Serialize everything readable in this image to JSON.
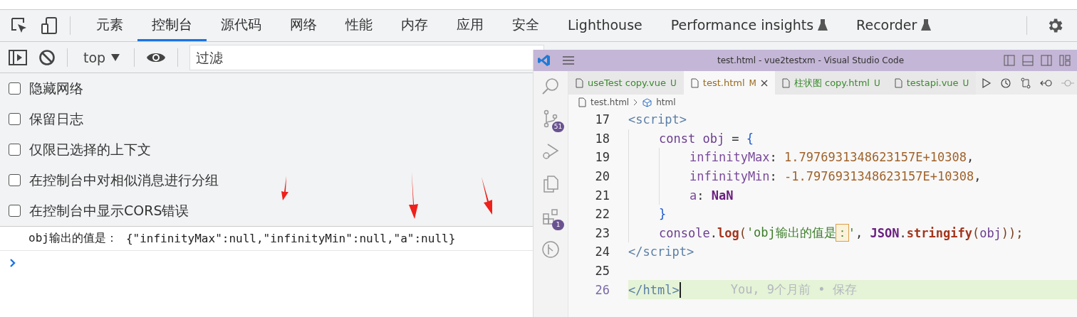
{
  "devtools": {
    "tabs": [
      {
        "label": "元素",
        "selected": false,
        "experimental": false
      },
      {
        "label": "控制台",
        "selected": true,
        "experimental": false
      },
      {
        "label": "源代码",
        "selected": false,
        "experimental": false
      },
      {
        "label": "网络",
        "selected": false,
        "experimental": false
      },
      {
        "label": "性能",
        "selected": false,
        "experimental": false
      },
      {
        "label": "内存",
        "selected": false,
        "experimental": false
      },
      {
        "label": "应用",
        "selected": false,
        "experimental": false
      },
      {
        "label": "安全",
        "selected": false,
        "experimental": false
      },
      {
        "label": "Lighthouse",
        "selected": false,
        "experimental": false
      },
      {
        "label": "Performance insights",
        "selected": false,
        "experimental": true
      },
      {
        "label": "Recorder",
        "selected": false,
        "experimental": true
      }
    ],
    "toolbar": {
      "context": "top",
      "filter": {
        "placeholder": "过滤"
      }
    },
    "settings": [
      {
        "label": "隐藏网络",
        "checked": false
      },
      {
        "label": "保留日志",
        "checked": false
      },
      {
        "label": "仅限已选择的上下文",
        "checked": false
      },
      {
        "label": "在控制台中对相似消息进行分组",
        "checked": false
      },
      {
        "label": "在控制台中显示CORS错误",
        "checked": false
      }
    ],
    "console": {
      "messages": [
        {
          "label": "obj输出的值是：",
          "value": "{\"infinityMax\":null,\"infinityMin\":null,\"a\":null}"
        }
      ]
    }
  },
  "vscode": {
    "window": {
      "title": "test.html - vue2testxm - Visual Studio Code"
    },
    "activity_bar": {
      "source_control_badge": "51",
      "extensions_badge": "1"
    },
    "tabs": [
      {
        "name": "useTest copy.vue",
        "status": "U",
        "color": "#3a8a2e",
        "selected": false
      },
      {
        "name": "test.html",
        "status": "M",
        "color": "#9a6a1c",
        "selected": true
      },
      {
        "name": "柱状图 copy.html",
        "status": "U",
        "color": "#3a8a2e",
        "selected": false
      },
      {
        "name": "testapi.vue",
        "status": "U",
        "color": "#3a8a2e",
        "selected": false
      }
    ],
    "breadcrumb": [
      "test.html",
      "html"
    ],
    "lines": [
      {
        "number": "17",
        "current": false,
        "kind": "top",
        "tokens": [
          {
            "kind": "tag",
            "text": "<script>"
          }
        ]
      },
      {
        "number": "18",
        "current": false,
        "kind": "body",
        "tokens": [
          {
            "kind": "keyword",
            "text": "const obj"
          },
          {
            "kind": "plain",
            "text": " = "
          },
          {
            "kind": "brace",
            "text": "{"
          }
        ]
      },
      {
        "number": "19",
        "current": false,
        "kind": "member",
        "tokens": [
          {
            "kind": "prop",
            "text": "infinityMax"
          },
          {
            "kind": "plain",
            "text": ": "
          },
          {
            "kind": "number",
            "text": "1.7976931348623157E+10308"
          },
          {
            "kind": "plain",
            "text": ","
          }
        ]
      },
      {
        "number": "20",
        "current": false,
        "kind": "member",
        "tokens": [
          {
            "kind": "prop",
            "text": "infinityMin"
          },
          {
            "kind": "plain",
            "text": ": "
          },
          {
            "kind": "number",
            "text": "-1.7976931348623157E+10308"
          },
          {
            "kind": "plain",
            "text": ","
          }
        ]
      },
      {
        "number": "21",
        "current": false,
        "kind": "member",
        "tokens": [
          {
            "kind": "prop",
            "text": "a"
          },
          {
            "kind": "plain",
            "text": ": "
          },
          {
            "kind": "constant",
            "text": "NaN"
          }
        ]
      },
      {
        "number": "22",
        "current": false,
        "kind": "body",
        "tokens": [
          {
            "kind": "brace",
            "text": "}"
          }
        ]
      },
      {
        "number": "23",
        "current": false,
        "kind": "body",
        "tokens": [
          {
            "kind": "keyword",
            "text": "console"
          },
          {
            "kind": "plain",
            "text": "."
          },
          {
            "kind": "func",
            "text": "log"
          },
          {
            "kind": "paren",
            "text": "("
          },
          {
            "kind": "string",
            "text": "'obj输出的值是"
          },
          {
            "kind": "highlight",
            "text": "："
          },
          {
            "kind": "string",
            "text": "'"
          },
          {
            "kind": "plain",
            "text": ", "
          },
          {
            "kind": "constant",
            "text": "JSON"
          },
          {
            "kind": "plain",
            "text": "."
          },
          {
            "kind": "func",
            "text": "stringify"
          },
          {
            "kind": "paren",
            "text": "("
          },
          {
            "kind": "keyword",
            "text": "obj"
          },
          {
            "kind": "paren",
            "text": "));"
          }
        ]
      },
      {
        "number": "24",
        "current": false,
        "kind": "top",
        "tokens": [
          {
            "kind": "tag",
            "text": "</script>"
          }
        ]
      },
      {
        "number": "25",
        "current": false,
        "kind": "top"
      },
      {
        "number": "26",
        "current": true,
        "kind": "top",
        "tokens": [
          {
            "kind": "tag",
            "text": "</html>"
          }
        ],
        "blame": "You, 9个月前 • 保存"
      }
    ]
  }
}
